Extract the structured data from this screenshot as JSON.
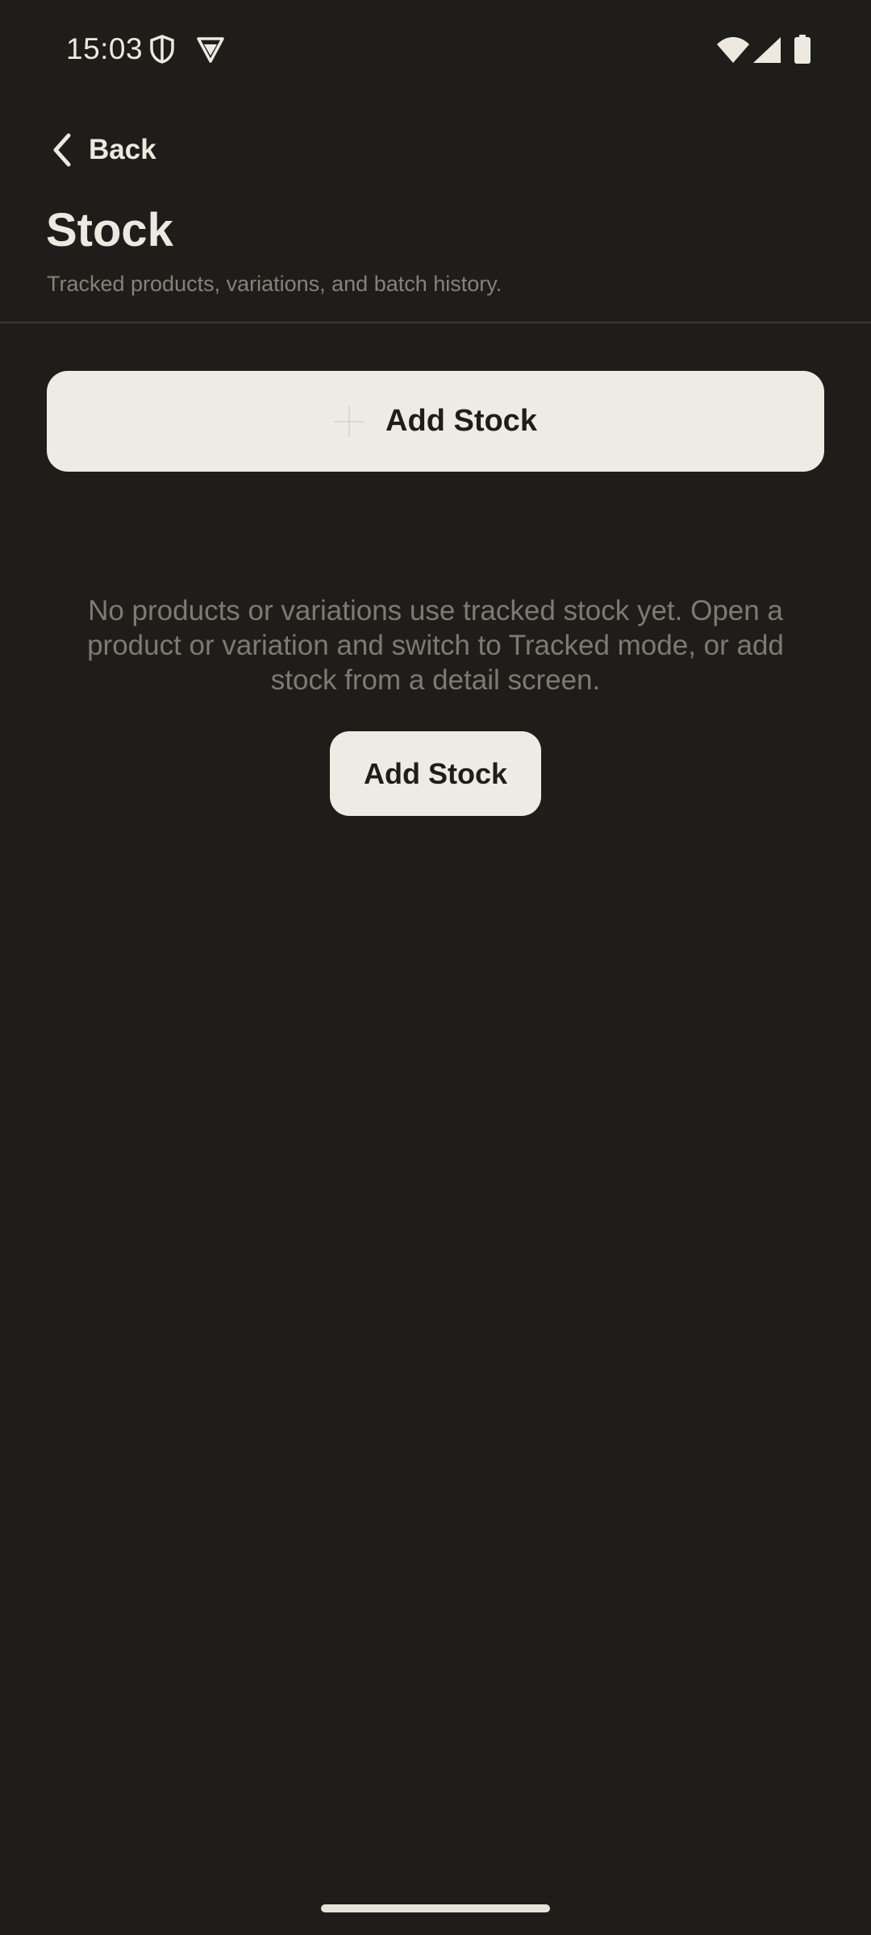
{
  "status_bar": {
    "time": "15:03",
    "icons": [
      "shield-icon",
      "vpn-icon",
      "wifi-icon",
      "signal-icon",
      "battery-icon"
    ]
  },
  "nav": {
    "back_label": "Back",
    "back_icon": "chevron-left-icon"
  },
  "header": {
    "title": "Stock",
    "subtitle": "Tracked products, variations, and batch history."
  },
  "primary_action": {
    "label": "Add Stock",
    "icon": "plus-icon"
  },
  "empty_state": {
    "message": "No products or variations use tracked stock yet. Open a product or variation and switch to Tracked mode, or add stock from a detail screen.",
    "button_label": "Add Stock"
  },
  "colors": {
    "background": "#1e1d1a",
    "button_fill": "#eeebe4",
    "button_text": "#1e1d1a",
    "primary_text": "#ede9e1",
    "secondary_text": "#86827b"
  }
}
